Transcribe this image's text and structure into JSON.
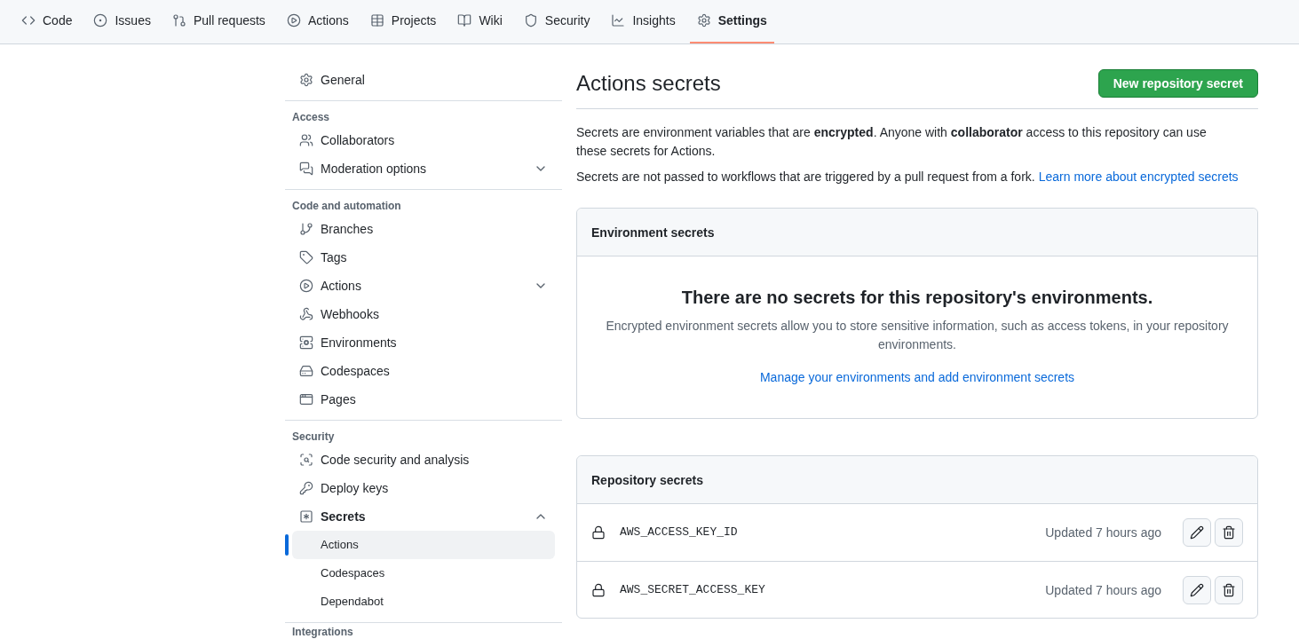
{
  "nav": {
    "tabs": [
      {
        "label": "Code",
        "selected": false
      },
      {
        "label": "Issues",
        "selected": false
      },
      {
        "label": "Pull requests",
        "selected": false
      },
      {
        "label": "Actions",
        "selected": false
      },
      {
        "label": "Projects",
        "selected": false
      },
      {
        "label": "Wiki",
        "selected": false
      },
      {
        "label": "Security",
        "selected": false
      },
      {
        "label": "Insights",
        "selected": false
      },
      {
        "label": "Settings",
        "selected": true
      }
    ]
  },
  "sidebar": {
    "sections": [
      {
        "items": [
          {
            "label": "General",
            "selected": false
          }
        ]
      },
      {
        "heading": "Access",
        "items": [
          {
            "label": "Collaborators",
            "selected": false
          },
          {
            "label": "Moderation options",
            "selected": false,
            "expanded": false
          }
        ]
      },
      {
        "heading": "Code and automation",
        "items": [
          {
            "label": "Branches",
            "selected": false
          },
          {
            "label": "Tags",
            "selected": false
          },
          {
            "label": "Actions",
            "selected": false,
            "expanded": false
          },
          {
            "label": "Webhooks",
            "selected": false
          },
          {
            "label": "Environments",
            "selected": false
          },
          {
            "label": "Codespaces",
            "selected": false
          },
          {
            "label": "Pages",
            "selected": false
          }
        ]
      },
      {
        "heading": "Security",
        "items": [
          {
            "label": "Code security and analysis",
            "selected": false
          },
          {
            "label": "Deploy keys",
            "selected": false
          },
          {
            "label": "Secrets",
            "selected": false,
            "expanded": true,
            "children": [
              {
                "label": "Actions",
                "selected": true
              },
              {
                "label": "Codespaces",
                "selected": false
              },
              {
                "label": "Dependabot",
                "selected": false
              }
            ]
          }
        ]
      },
      {
        "heading": "Integrations"
      }
    ]
  },
  "content": {
    "title": "Actions secrets",
    "new_button": "New repository secret",
    "intro": "Secrets are environment variables that are **encrypted**. Anyone with **collaborator** access to this repository can use these secrets for Actions.",
    "note": "Secrets are not passed to workflows that are triggered by a pull request from a fork.",
    "note_link": "Learn more about encrypted secrets",
    "environment_secrets": {
      "heading": "Environment secrets",
      "blank_title": "There are no secrets for this repository's environments.",
      "blank_text": "Encrypted environment secrets allow you to store sensitive information, such as access tokens, in your repository environments.",
      "link": "Manage your environments and add environment secrets"
    },
    "repository_secrets": {
      "heading": "Repository secrets",
      "rows": [
        {
          "name": "AWS_ACCESS_KEY_ID",
          "updated": "Updated 7 hours ago"
        },
        {
          "name": "AWS_SECRET_ACCESS_KEY",
          "updated": "Updated 7 hours ago"
        }
      ]
    }
  }
}
